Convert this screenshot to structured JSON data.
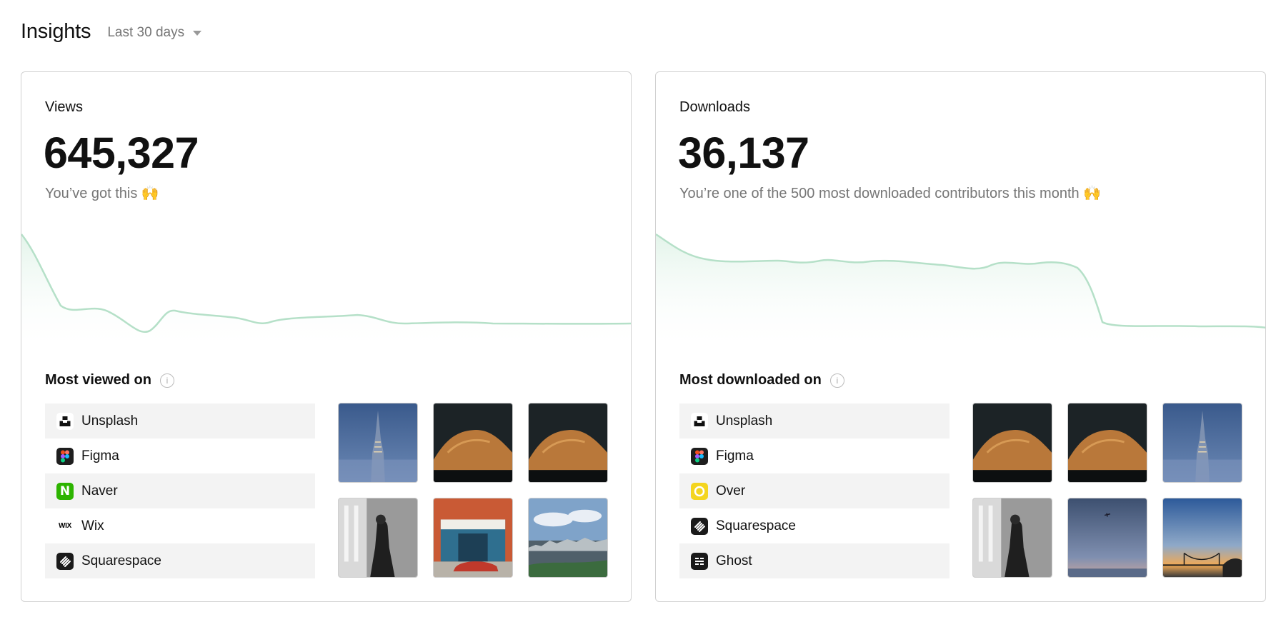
{
  "header": {
    "title": "Insights",
    "range_label": "Last 30 days"
  },
  "views": {
    "label": "Views",
    "value": "645,327",
    "subtext": "You’ve got this 🙌",
    "section_title": "Most viewed on",
    "platforms": [
      {
        "label": "Unsplash",
        "icon": "unsplash-icon"
      },
      {
        "label": "Figma",
        "icon": "figma-icon"
      },
      {
        "label": "Naver",
        "icon": "naver-icon"
      },
      {
        "label": "Wix",
        "icon": "wix-icon"
      },
      {
        "label": "Squarespace",
        "icon": "squarespace-icon"
      }
    ],
    "thumbnails": [
      "spire-in-fog-photo",
      "mountain-at-night-photo",
      "mountain-at-night-photo",
      "person-in-corridor-bw-photo",
      "storefront-with-red-car-photo",
      "city-skyline-photo"
    ]
  },
  "downloads": {
    "label": "Downloads",
    "value": "36,137",
    "subtext": "You’re one of the 500 most downloaded contributors this month 🙌",
    "section_title": "Most downloaded on",
    "platforms": [
      {
        "label": "Unsplash",
        "icon": "unsplash-icon"
      },
      {
        "label": "Figma",
        "icon": "figma-icon"
      },
      {
        "label": "Over",
        "icon": "over-icon"
      },
      {
        "label": "Squarespace",
        "icon": "squarespace-icon"
      },
      {
        "label": "Ghost",
        "icon": "ghost-icon"
      }
    ],
    "thumbnails": [
      "mountain-at-night-photo",
      "mountain-at-night-photo",
      "spire-in-fog-photo",
      "person-in-corridor-bw-photo",
      "dusk-sky-photo",
      "golden-gate-sunset-photo"
    ]
  },
  "colors": {
    "sparkline": "#b5e0c8",
    "sparkline_fill": "#eef8f2",
    "row_shade": "#f3f3f3",
    "naver_green": "#2db400",
    "over_yellow": "#f4d51e"
  }
}
